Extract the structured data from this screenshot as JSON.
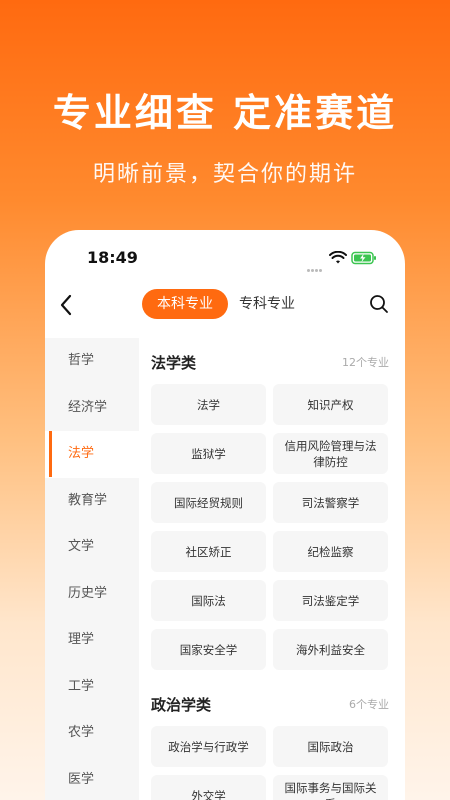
{
  "hero": {
    "title": "专业细查 定准赛道",
    "subtitle": "明晰前景，契合你的期许"
  },
  "status_bar": {
    "time": "18:49"
  },
  "nav": {
    "tab_undergrad": "本科专业",
    "tab_vocational": "专科专业"
  },
  "sidebar": {
    "items": [
      {
        "label": "哲学"
      },
      {
        "label": "经济学"
      },
      {
        "label": "法学"
      },
      {
        "label": "教育学"
      },
      {
        "label": "文学"
      },
      {
        "label": "历史学"
      },
      {
        "label": "理学"
      },
      {
        "label": "工学"
      },
      {
        "label": "农学"
      },
      {
        "label": "医学"
      }
    ],
    "active_index": 2
  },
  "sections": [
    {
      "title": "法学类",
      "count": "12个专业",
      "majors": [
        "法学",
        "知识产权",
        "监狱学",
        "信用风险管理与法律防控",
        "国际经贸规则",
        "司法警察学",
        "社区矫正",
        "纪检监察",
        "国际法",
        "司法鉴定学",
        "国家安全学",
        "海外利益安全"
      ]
    },
    {
      "title": "政治学类",
      "count": "6个专业",
      "majors": [
        "政治学与行政学",
        "国际政治",
        "外交学",
        "国际事务与国际关系"
      ]
    }
  ],
  "colors": {
    "accent": "#ff6a10"
  },
  "icons": {
    "back": "chevron-left-icon",
    "search": "search-icon",
    "wifi": "wifi-icon",
    "battery": "battery-charging-icon"
  }
}
